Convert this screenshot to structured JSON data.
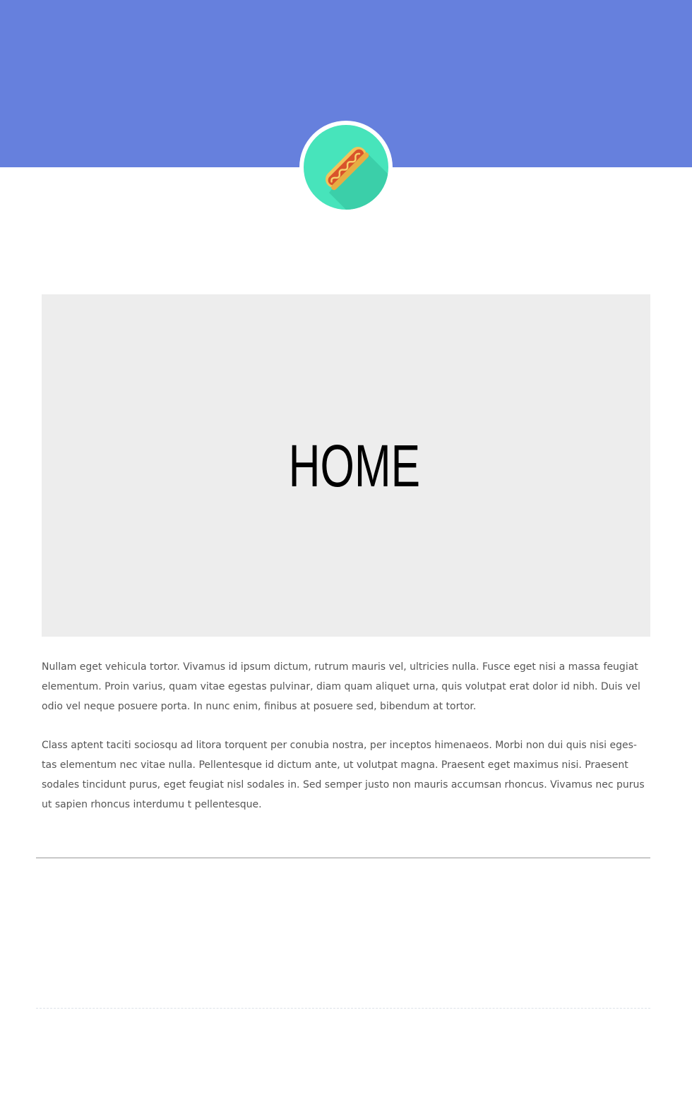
{
  "colors": {
    "header_background": "#6680dd",
    "badge_background": "#47e4bb",
    "hero_background": "#ededed",
    "body_text": "#555555"
  },
  "logo": {
    "icon": "hotdog-icon"
  },
  "hero": {
    "title": "HOME"
  },
  "content": {
    "paragraphs": [
      {
        "lines": [
          "Nullam eget vehicula tortor. Vivamus id ipsum dictum, rutrum mauris vel, ultricies nulla. Fusce eget nisi a massa feugiat",
          "elementum. Proin varius, quam vitae egestas pulvinar, diam quam aliquet urna, quis volutpat erat dolor id nibh. Duis vel",
          "odio vel neque posuere porta. In nunc enim, finibus at posuere sed, bibendum at tortor."
        ]
      },
      {
        "lines": [
          "Class aptent taciti sociosqu ad litora torquent per conubia nostra, per inceptos himenaeos. Morbi non dui quis nisi eges-",
          "tas elementum nec vitae nulla. Pellentesque id dictum ante, ut volutpat magna. Praesent eget maximus nisi. Praesent",
          "sodales tincidunt purus, eget feugiat nisl sodales in. Sed semper justo non mauris accumsan rhoncus. Vivamus nec purus",
          "ut sapien rhoncus interdumu t pellentesque."
        ]
      }
    ]
  }
}
